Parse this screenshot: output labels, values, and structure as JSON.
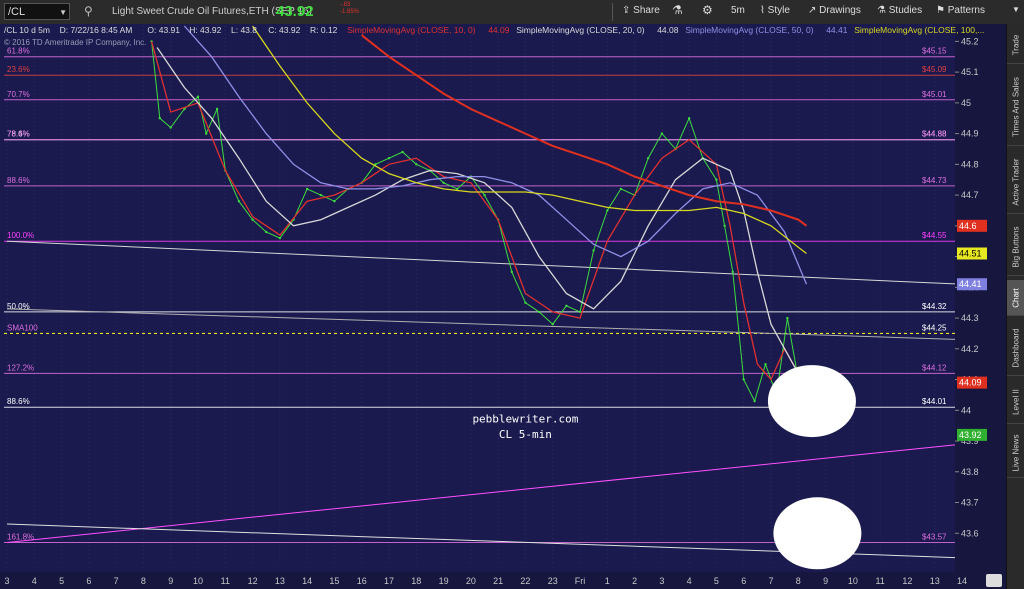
{
  "toolbar": {
    "symbol": "/CL",
    "title": "Light Sweet Crude Oil Futures,ETH (SEP 16)",
    "last": "43.92",
    "change": "-.83",
    "change_pct": "-1.85%",
    "share_label": "Share",
    "timeframe_label": "5m",
    "style_label": "Style",
    "drawings_label": "Drawings",
    "studies_label": "Studies",
    "patterns_label": "Patterns"
  },
  "side_tabs": [
    "Trade",
    "Times And Sales",
    "Active Trader",
    "Big Buttons",
    "Chart",
    "Dashboard",
    "Level II",
    "Live News"
  ],
  "side_tab_active": "Chart",
  "chart_data": {
    "type": "line",
    "info": {
      "symbol_period": "/CL 10 d 5m",
      "date": "D: 7/22/16 8:45 AM",
      "open": "O: 43.91",
      "high": "H: 43.92",
      "low": "L: 43.8",
      "close": "C: 43.92",
      "range": "R: 0.12",
      "copyright": "© 2016 TD Ameritrade IP Company, Inc."
    },
    "studies": [
      {
        "label": "SimpleMovingAvg (CLOSE, 10, 0)",
        "value": "44.09",
        "color": "#e03030"
      },
      {
        "label": "SimpleMovingAvg (CLOSE, 20, 0)",
        "value": "44.08",
        "color": "#d8d8d8"
      },
      {
        "label": "SimpleMovingAvg (CLOSE, 50, 0)",
        "value": "44.41",
        "color": "#8f8fe8"
      },
      {
        "label": "SimpleMovingAvg (CLOSE, 100,...",
        "value": "",
        "color": "#d8d820"
      }
    ],
    "y_axis": {
      "ylim": [
        43.5,
        45.25
      ],
      "ticks": [
        {
          "value": 43.6,
          "label": "43.6"
        },
        {
          "value": 43.7,
          "label": "43.7"
        },
        {
          "value": 43.8,
          "label": "43.8"
        },
        {
          "value": 43.9,
          "label": "43.9"
        },
        {
          "value": 44.0,
          "label": "44"
        },
        {
          "value": 44.1,
          "label": "44.1"
        },
        {
          "value": 44.2,
          "label": "44.2"
        },
        {
          "value": 44.3,
          "label": "44.3"
        },
        {
          "value": 44.4,
          "label": "44.4"
        },
        {
          "value": 44.5,
          "label": "44.5"
        },
        {
          "value": 44.6,
          "label": "44.6"
        },
        {
          "value": 44.7,
          "label": "44.7"
        },
        {
          "value": 44.8,
          "label": "44.8"
        },
        {
          "value": 44.9,
          "label": "44.9"
        },
        {
          "value": 45.0,
          "label": "45"
        },
        {
          "value": 45.1,
          "label": "45.1"
        },
        {
          "value": 45.2,
          "label": "45.2"
        }
      ]
    },
    "x_axis": {
      "xlim": [
        0,
        35
      ],
      "ticks": [
        {
          "x": 0,
          "label": "3"
        },
        {
          "x": 1,
          "label": "4"
        },
        {
          "x": 2,
          "label": "5"
        },
        {
          "x": 3,
          "label": "6"
        },
        {
          "x": 4,
          "label": "7"
        },
        {
          "x": 5,
          "label": "8"
        },
        {
          "x": 6,
          "label": "9"
        },
        {
          "x": 7,
          "label": "10"
        },
        {
          "x": 8,
          "label": "11"
        },
        {
          "x": 9,
          "label": "12"
        },
        {
          "x": 10,
          "label": "13"
        },
        {
          "x": 11,
          "label": "14"
        },
        {
          "x": 12,
          "label": "15"
        },
        {
          "x": 13,
          "label": "16"
        },
        {
          "x": 14,
          "label": "17"
        },
        {
          "x": 15,
          "label": "18"
        },
        {
          "x": 16,
          "label": "19"
        },
        {
          "x": 17,
          "label": "20"
        },
        {
          "x": 18,
          "label": "21"
        },
        {
          "x": 19,
          "label": "22"
        },
        {
          "x": 20,
          "label": "23"
        },
        {
          "x": 21,
          "label": "Fri"
        },
        {
          "x": 22,
          "label": "1"
        },
        {
          "x": 23,
          "label": "2"
        },
        {
          "x": 24,
          "label": "3"
        },
        {
          "x": 25,
          "label": "4"
        },
        {
          "x": 26,
          "label": "5"
        },
        {
          "x": 27,
          "label": "6"
        },
        {
          "x": 28,
          "label": "7"
        },
        {
          "x": 29,
          "label": "8"
        },
        {
          "x": 30,
          "label": "9"
        },
        {
          "x": 31,
          "label": "10"
        },
        {
          "x": 32,
          "label": "11"
        },
        {
          "x": 33,
          "label": "12"
        },
        {
          "x": 34,
          "label": "13"
        },
        {
          "x": 35,
          "label": "14"
        }
      ]
    },
    "fib_levels": [
      {
        "label": "61.8%",
        "value": 45.15,
        "color": "#e070e0"
      },
      {
        "label": "23.6%",
        "value": 45.09,
        "color": "#e04040"
      },
      {
        "label": "70.7%",
        "value": 45.01,
        "color": "#e070e0"
      },
      {
        "label": "78.6%",
        "value": 44.88,
        "color": "#ffffff"
      },
      {
        "label": "76.4%",
        "value": 44.88,
        "color": "#e070e0"
      },
      {
        "label": "88.6%",
        "value": 44.73,
        "color": "#e070e0"
      },
      {
        "label": "100.0%",
        "value": 44.55,
        "color": "#ff40ff"
      },
      {
        "label": "50.0%",
        "value": 44.32,
        "color": "#ffffff"
      },
      {
        "label": "127.2%",
        "value": 44.12,
        "color": "#e070e0"
      },
      {
        "label": "88.6%",
        "value": 44.01,
        "color": "#ffffff"
      },
      {
        "label": "161.8%",
        "value": 43.57,
        "color": "#e070e0"
      }
    ],
    "fib_right_labels": [
      {
        "text": "$45.15",
        "value": 45.15,
        "color": "#e070e0"
      },
      {
        "text": "$45.09",
        "value": 45.09,
        "color": "#e04040"
      },
      {
        "text": "$45.01",
        "value": 45.01,
        "color": "#e070e0"
      },
      {
        "text": "$44.88",
        "value": 44.88,
        "color": "#ffffff"
      },
      {
        "text": "$44.88",
        "value": 44.88,
        "color": "#e070e0"
      },
      {
        "text": "$44.73",
        "value": 44.73,
        "color": "#e070e0"
      },
      {
        "text": "$44.55",
        "value": 44.55,
        "color": "#ff40ff"
      },
      {
        "text": "$44.32",
        "value": 44.32,
        "color": "#ffffff"
      },
      {
        "text": "$44.12",
        "value": 44.12,
        "color": "#e070e0"
      },
      {
        "text": "$44.01",
        "value": 44.01,
        "color": "#ffffff"
      },
      {
        "text": "$43.57",
        "value": 43.57,
        "color": "#e070e0"
      }
    ],
    "sma100_line": {
      "label": "SMA100",
      "value": 44.25,
      "right_label": "$44.25",
      "color": "#e8e820"
    },
    "price_badges": [
      {
        "text": "44.6",
        "value": 44.6,
        "bg": "#e03020",
        "fg": "#ffffff"
      },
      {
        "text": "44.51",
        "value": 44.51,
        "bg": "#e8e820",
        "fg": "#000000"
      },
      {
        "text": "44.41",
        "value": 44.41,
        "bg": "#8080e0",
        "fg": "#ffffff"
      },
      {
        "text": "44.09",
        "value": 44.09,
        "bg": "#e03020",
        "fg": "#ffffff"
      },
      {
        "text": "43.92",
        "value": 43.92,
        "bg": "#30b030",
        "fg": "#ffffff"
      }
    ],
    "trendlines": [
      {
        "name": "upper-descending",
        "x0": 0,
        "y0": 44.55,
        "x1": 35,
        "y1": 44.41,
        "color": "#d8d8d8"
      },
      {
        "name": "lower-descending",
        "x0": 0,
        "y0": 44.33,
        "x1": 35,
        "y1": 44.23,
        "color": "#b0b0b0"
      },
      {
        "name": "rising-support",
        "x0": 0,
        "y0": 43.57,
        "x1": 35,
        "y1": 43.89,
        "color": "#ff50ff"
      },
      {
        "name": "bottom-descending",
        "x0": 0,
        "y0": 43.63,
        "x1": 35,
        "y1": 43.52,
        "color": "#e0e0e0"
      }
    ],
    "series": [
      {
        "name": "price",
        "color": "#3ddc3d",
        "x": [
          5.3,
          5.6,
          6.0,
          6.5,
          7.0,
          7.3,
          7.7,
          8.0,
          8.5,
          9.0,
          9.5,
          10.0,
          10.5,
          11.0,
          11.5,
          12.0,
          12.5,
          13.0,
          13.5,
          14.0,
          14.5,
          15.0,
          15.5,
          16.0,
          16.5,
          17.0,
          17.5,
          18.0,
          18.5,
          19.0,
          19.5,
          20.0,
          20.5,
          21.0,
          21.5,
          22.0,
          22.5,
          23.0,
          23.5,
          24.0,
          24.5,
          25.0,
          25.5,
          26.0,
          26.3,
          26.6,
          27.0,
          27.4,
          27.8,
          28.2,
          28.6,
          29.0,
          29.3
        ],
        "y": [
          45.2,
          44.95,
          44.92,
          44.98,
          45.02,
          44.9,
          44.98,
          44.78,
          44.68,
          44.62,
          44.58,
          44.56,
          44.62,
          44.72,
          44.7,
          44.68,
          44.72,
          44.74,
          44.8,
          44.82,
          44.84,
          44.8,
          44.78,
          44.74,
          44.72,
          44.76,
          44.7,
          44.62,
          44.45,
          44.35,
          44.32,
          44.28,
          44.34,
          44.32,
          44.52,
          44.65,
          44.72,
          44.7,
          44.82,
          44.9,
          44.85,
          44.95,
          44.82,
          44.75,
          44.6,
          44.45,
          44.1,
          44.03,
          44.15,
          44.05,
          44.3,
          44.1,
          43.92
        ]
      },
      {
        "name": "SMA 10",
        "color": "#e03030",
        "x": [
          5.3,
          6.0,
          7.0,
          8.0,
          9.0,
          10.0,
          11.0,
          12.0,
          13.0,
          14.0,
          15.0,
          16.0,
          17.0,
          18.0,
          19.0,
          20.0,
          21.0,
          22.0,
          23.0,
          24.0,
          25.0,
          26.0,
          26.5,
          27.0,
          27.5,
          28.0,
          28.5,
          29.0,
          29.3
        ],
        "y": [
          45.2,
          44.97,
          45.0,
          44.78,
          44.63,
          44.57,
          44.68,
          44.7,
          44.74,
          44.8,
          44.82,
          44.76,
          44.74,
          44.62,
          44.38,
          44.32,
          44.3,
          44.55,
          44.7,
          44.82,
          44.88,
          44.8,
          44.6,
          44.35,
          44.15,
          44.1,
          44.2,
          44.12,
          44.09
        ]
      },
      {
        "name": "SMA 20",
        "color": "#d8d8d8",
        "x": [
          5.5,
          6.5,
          7.5,
          8.5,
          9.5,
          10.5,
          11.5,
          12.5,
          13.5,
          14.5,
          15.5,
          16.5,
          17.5,
          18.5,
          19.5,
          20.5,
          21.5,
          22.5,
          23.5,
          24.5,
          25.5,
          26.5,
          27.0,
          27.5,
          28.0,
          28.5,
          29.0,
          29.3
        ],
        "y": [
          45.18,
          45.05,
          44.95,
          44.82,
          44.68,
          44.6,
          44.62,
          44.66,
          44.7,
          44.75,
          44.78,
          44.77,
          44.74,
          44.66,
          44.5,
          44.38,
          44.33,
          44.42,
          44.6,
          44.75,
          44.82,
          44.78,
          44.65,
          44.45,
          44.28,
          44.2,
          44.12,
          44.08
        ]
      },
      {
        "name": "SMA 50",
        "color": "#8f8fe8",
        "x": [
          6.5,
          7.5,
          8.5,
          9.5,
          10.5,
          11.5,
          12.5,
          13.5,
          14.5,
          15.5,
          16.5,
          17.5,
          18.5,
          19.5,
          20.5,
          21.5,
          22.5,
          23.5,
          24.5,
          25.5,
          26.5,
          27.5,
          28.5,
          29.3
        ],
        "y": [
          45.25,
          45.15,
          45.02,
          44.9,
          44.8,
          44.74,
          44.72,
          44.72,
          44.73,
          44.75,
          44.76,
          44.76,
          44.74,
          44.7,
          44.62,
          44.54,
          44.5,
          44.55,
          44.64,
          44.72,
          44.74,
          44.7,
          44.58,
          44.41
        ]
      },
      {
        "name": "SMA 100",
        "color": "#d8d820",
        "x": [
          9.0,
          10.0,
          11.0,
          12.0,
          13.0,
          14.0,
          15.0,
          16.0,
          17.0,
          18.0,
          19.0,
          20.0,
          21.0,
          22.0,
          23.0,
          24.0,
          25.0,
          26.0,
          27.0,
          28.0,
          29.0,
          29.3
        ],
        "y": [
          45.25,
          45.12,
          45.0,
          44.9,
          44.82,
          44.77,
          44.74,
          44.72,
          44.71,
          44.71,
          44.71,
          44.7,
          44.68,
          44.66,
          44.65,
          44.65,
          44.65,
          44.66,
          44.64,
          44.6,
          44.53,
          44.51
        ]
      },
      {
        "name": "SMA 200",
        "color": "#e03020",
        "x": [
          13.0,
          14.0,
          15.0,
          16.0,
          17.0,
          18.0,
          19.0,
          20.0,
          21.0,
          22.0,
          23.0,
          24.0,
          25.0,
          26.0,
          27.0,
          28.0,
          29.0,
          29.3
        ],
        "y": [
          45.22,
          45.15,
          45.09,
          45.03,
          44.98,
          44.94,
          44.9,
          44.86,
          44.83,
          44.8,
          44.76,
          44.73,
          44.7,
          44.68,
          44.67,
          44.65,
          44.62,
          44.6
        ]
      }
    ],
    "annotations": [
      {
        "text": "pebblewriter.com",
        "x": 19.0,
        "y": 43.96
      },
      {
        "text": "CL 5-min",
        "x": 19.0,
        "y": 43.91
      }
    ],
    "highlights": [
      {
        "name": "circle-upper",
        "x": 29.5,
        "y": 44.03
      },
      {
        "name": "circle-lower",
        "x": 29.7,
        "y": 43.6
      }
    ]
  }
}
